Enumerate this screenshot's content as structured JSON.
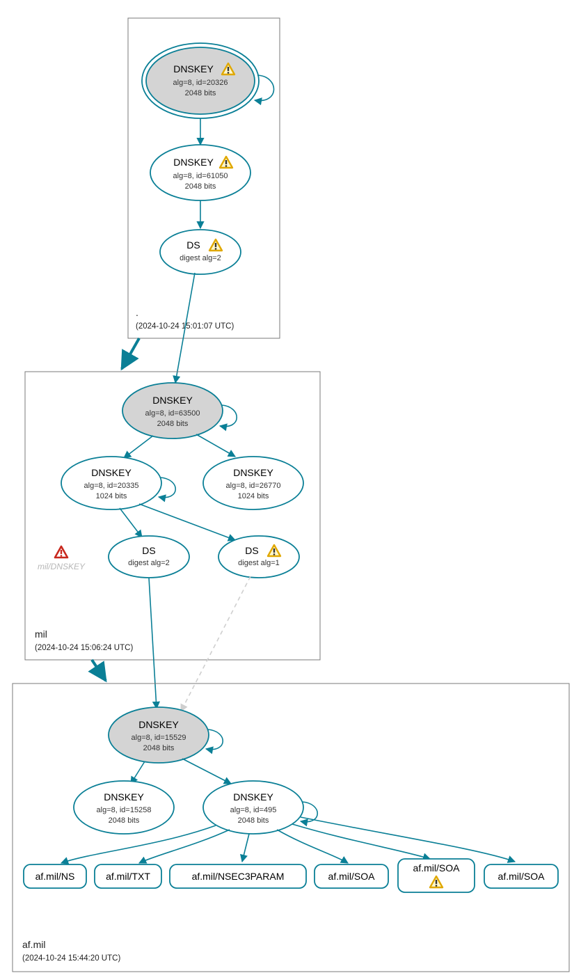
{
  "colors": {
    "edge": "#0a7f96",
    "ksk_fill": "#d4d4d4",
    "box": "#787878"
  },
  "zones": {
    "root": {
      "name": ".",
      "timestamp": "(2024-10-24 15:01:07 UTC)"
    },
    "mil": {
      "name": "mil",
      "timestamp": "(2024-10-24 15:06:24 UTC)"
    },
    "afmil": {
      "name": "af.mil",
      "timestamp": "(2024-10-24 15:44:20 UTC)"
    }
  },
  "nodes": {
    "root_ksk": {
      "title": "DNSKEY",
      "sub1": "alg=8, id=20326",
      "sub2": "2048 bits",
      "warn": true
    },
    "root_zsk": {
      "title": "DNSKEY",
      "sub1": "alg=8, id=61050",
      "sub2": "2048 bits",
      "warn": true
    },
    "root_ds": {
      "title": "DS",
      "sub1": "digest alg=2",
      "warn": true
    },
    "mil_ksk": {
      "title": "DNSKEY",
      "sub1": "alg=8, id=63500",
      "sub2": "2048 bits"
    },
    "mil_zsk1": {
      "title": "DNSKEY",
      "sub1": "alg=8, id=20335",
      "sub2": "1024 bits"
    },
    "mil_zsk2": {
      "title": "DNSKEY",
      "sub1": "alg=8, id=26770",
      "sub2": "1024 bits"
    },
    "mil_ds1": {
      "title": "DS",
      "sub1": "digest alg=2"
    },
    "mil_ds2": {
      "title": "DS",
      "sub1": "digest alg=1",
      "warn": true
    },
    "afmil_ksk": {
      "title": "DNSKEY",
      "sub1": "alg=8, id=15529",
      "sub2": "2048 bits"
    },
    "afmil_zsk1": {
      "title": "DNSKEY",
      "sub1": "alg=8, id=15258",
      "sub2": "2048 bits"
    },
    "afmil_zsk2": {
      "title": "DNSKEY",
      "sub1": "alg=8, id=495",
      "sub2": "2048 bits"
    }
  },
  "bad_link_label": "mil/DNSKEY",
  "rrsets": [
    {
      "label": "af.mil/NS"
    },
    {
      "label": "af.mil/TXT"
    },
    {
      "label": "af.mil/NSEC3PARAM"
    },
    {
      "label": "af.mil/SOA"
    },
    {
      "label": "af.mil/SOA",
      "warn": true
    },
    {
      "label": "af.mil/SOA"
    }
  ]
}
